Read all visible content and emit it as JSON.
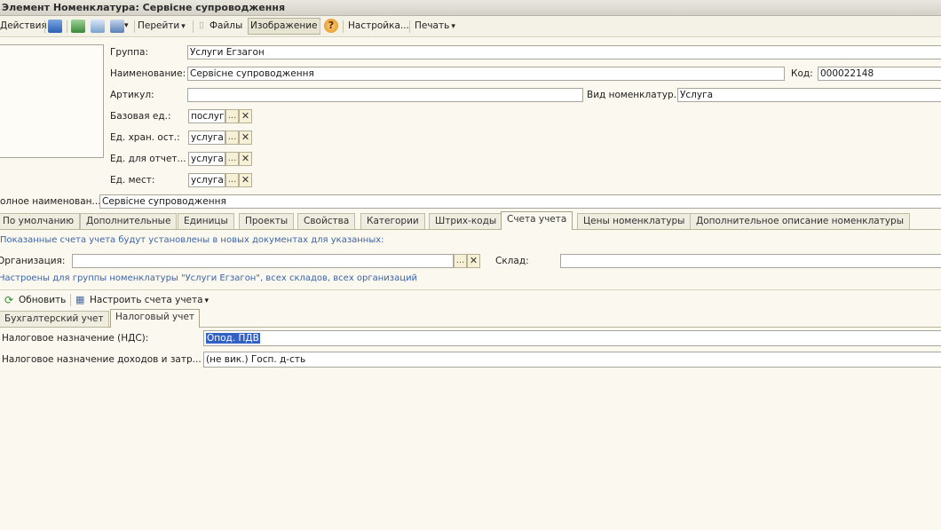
{
  "window": {
    "title": "Элемент Номенклатура: Сервісне супроводження"
  },
  "toolbar": {
    "actions_label": "Действия",
    "goto_label": "Перейти",
    "files_label": "Файлы",
    "image_label": "Изображение",
    "settings_label": "Настройка...",
    "print_label": "Печать"
  },
  "form": {
    "group": {
      "label": "Группа:",
      "value": "Услуги Егзагон"
    },
    "name": {
      "label": "Наименование:",
      "value": "Сервісне супроводження"
    },
    "code": {
      "label": "Код:",
      "value": "000022148"
    },
    "article": {
      "label": "Артикул:",
      "value": ""
    },
    "nom_type": {
      "label": "Вид номенклатур...",
      "value": "Услуга"
    },
    "base_unit": {
      "label": "Базовая ед.:",
      "value": "послуг"
    },
    "storage_unit": {
      "label": "Ед. хран. ост.:",
      "value": "услуга"
    },
    "report_unit": {
      "label": "Ед. для отчет...",
      "value": "услуга"
    },
    "place_unit": {
      "label": "Ед. мест:",
      "value": "услуга"
    },
    "full_name": {
      "label": "олное наименован...",
      "value": "Сервісне супроводження"
    },
    "dots": "...",
    "clear": "✕"
  },
  "tabs": [
    {
      "label": "По умолчанию"
    },
    {
      "label": "Дополнительные"
    },
    {
      "label": "Единицы"
    },
    {
      "label": "Проекты"
    },
    {
      "label": "Свойства"
    },
    {
      "label": "Категории"
    },
    {
      "label": "Штрих-коды"
    },
    {
      "label": "Счета учета"
    },
    {
      "label": "Цены номенклатуры"
    },
    {
      "label": "Дополнительное описание номенклатуры"
    }
  ],
  "accounts": {
    "info_text": "Показанные счета учета будут установлены в новых документах для указанных:",
    "org_label": "Организация:",
    "org_value": "",
    "warehouse_label": "Склад:",
    "warehouse_value": "",
    "configured_text": "Настроены для группы номенклатуры \"Услуги Егзагон\", всех складов, всех организаций",
    "refresh_label": "Обновить",
    "setup_label": "Настроить счета учета",
    "subtabs": [
      {
        "label": "Бухгалтерский учет"
      },
      {
        "label": "Налоговый учет"
      }
    ],
    "rows": [
      {
        "label": "Налоговое назначение (НДС):",
        "value": "Опод. ПДВ"
      },
      {
        "label": "Налоговое назначение доходов и затр...",
        "value": "(не вик.) Госп. д-сть"
      }
    ]
  }
}
